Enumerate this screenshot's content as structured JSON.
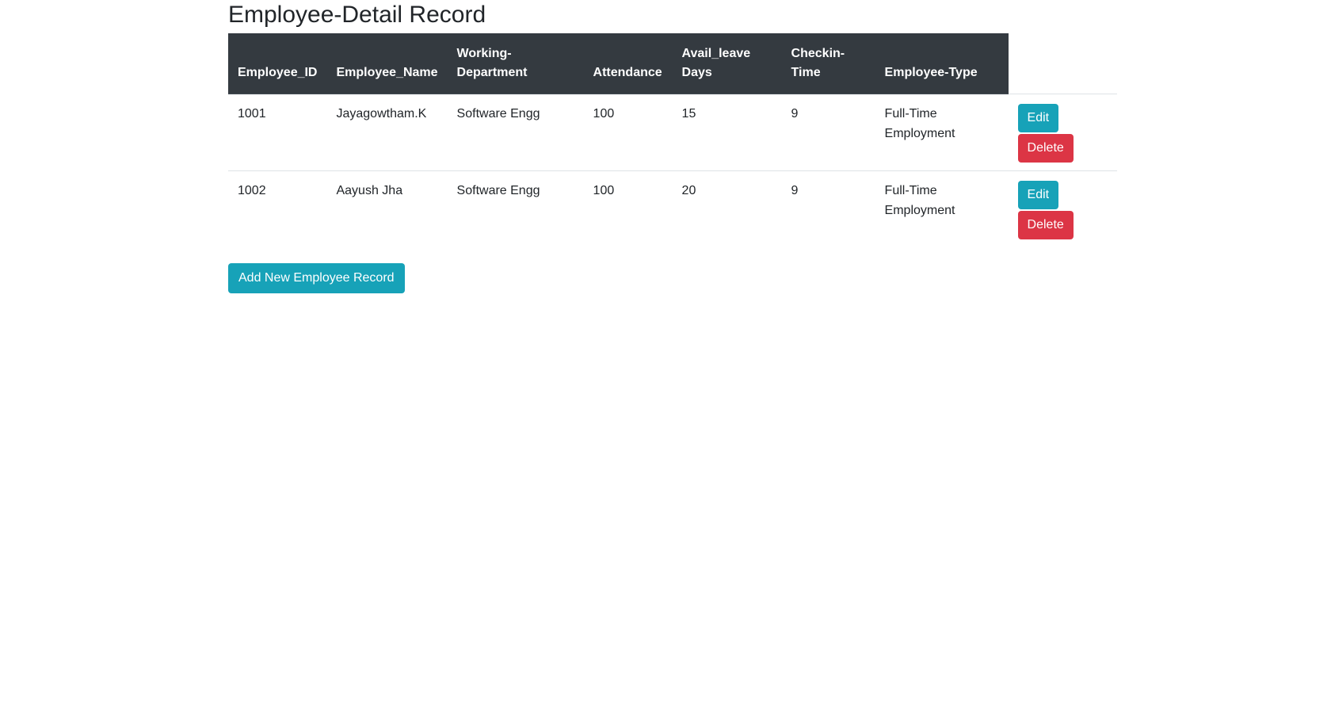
{
  "page": {
    "title": "Employee-Detail Record"
  },
  "table": {
    "headers": {
      "id": "Employee_ID",
      "name": "Employee_Name",
      "dept_line1": "Working-",
      "dept_line2": "Department",
      "attendance": "Attendance",
      "leave_line1": "Avail_leave",
      "leave_line2": "Days",
      "checkin_line1": "Checkin-",
      "checkin_line2": "Time",
      "type": "Employee-Type"
    },
    "rows": [
      {
        "id": "1001",
        "name": "Jayagowtham.K",
        "department": "Software Engg",
        "attendance": "100",
        "leave_days": "15",
        "checkin": "9",
        "type_line1": "Full-Time",
        "type_line2": "Employment",
        "edit_label": "Edit",
        "delete_label": "Delete"
      },
      {
        "id": "1002",
        "name": "Aayush Jha",
        "department": "Software Engg",
        "attendance": "100",
        "leave_days": "20",
        "checkin": "9",
        "type_line1": "Full-Time",
        "type_line2": "Employment",
        "edit_label": "Edit",
        "delete_label": "Delete"
      }
    ]
  },
  "actions": {
    "add_label": "Add New Employee Record"
  },
  "colors": {
    "header_bg": "#343a40",
    "info": "#17a2b8",
    "danger": "#dc3545"
  }
}
